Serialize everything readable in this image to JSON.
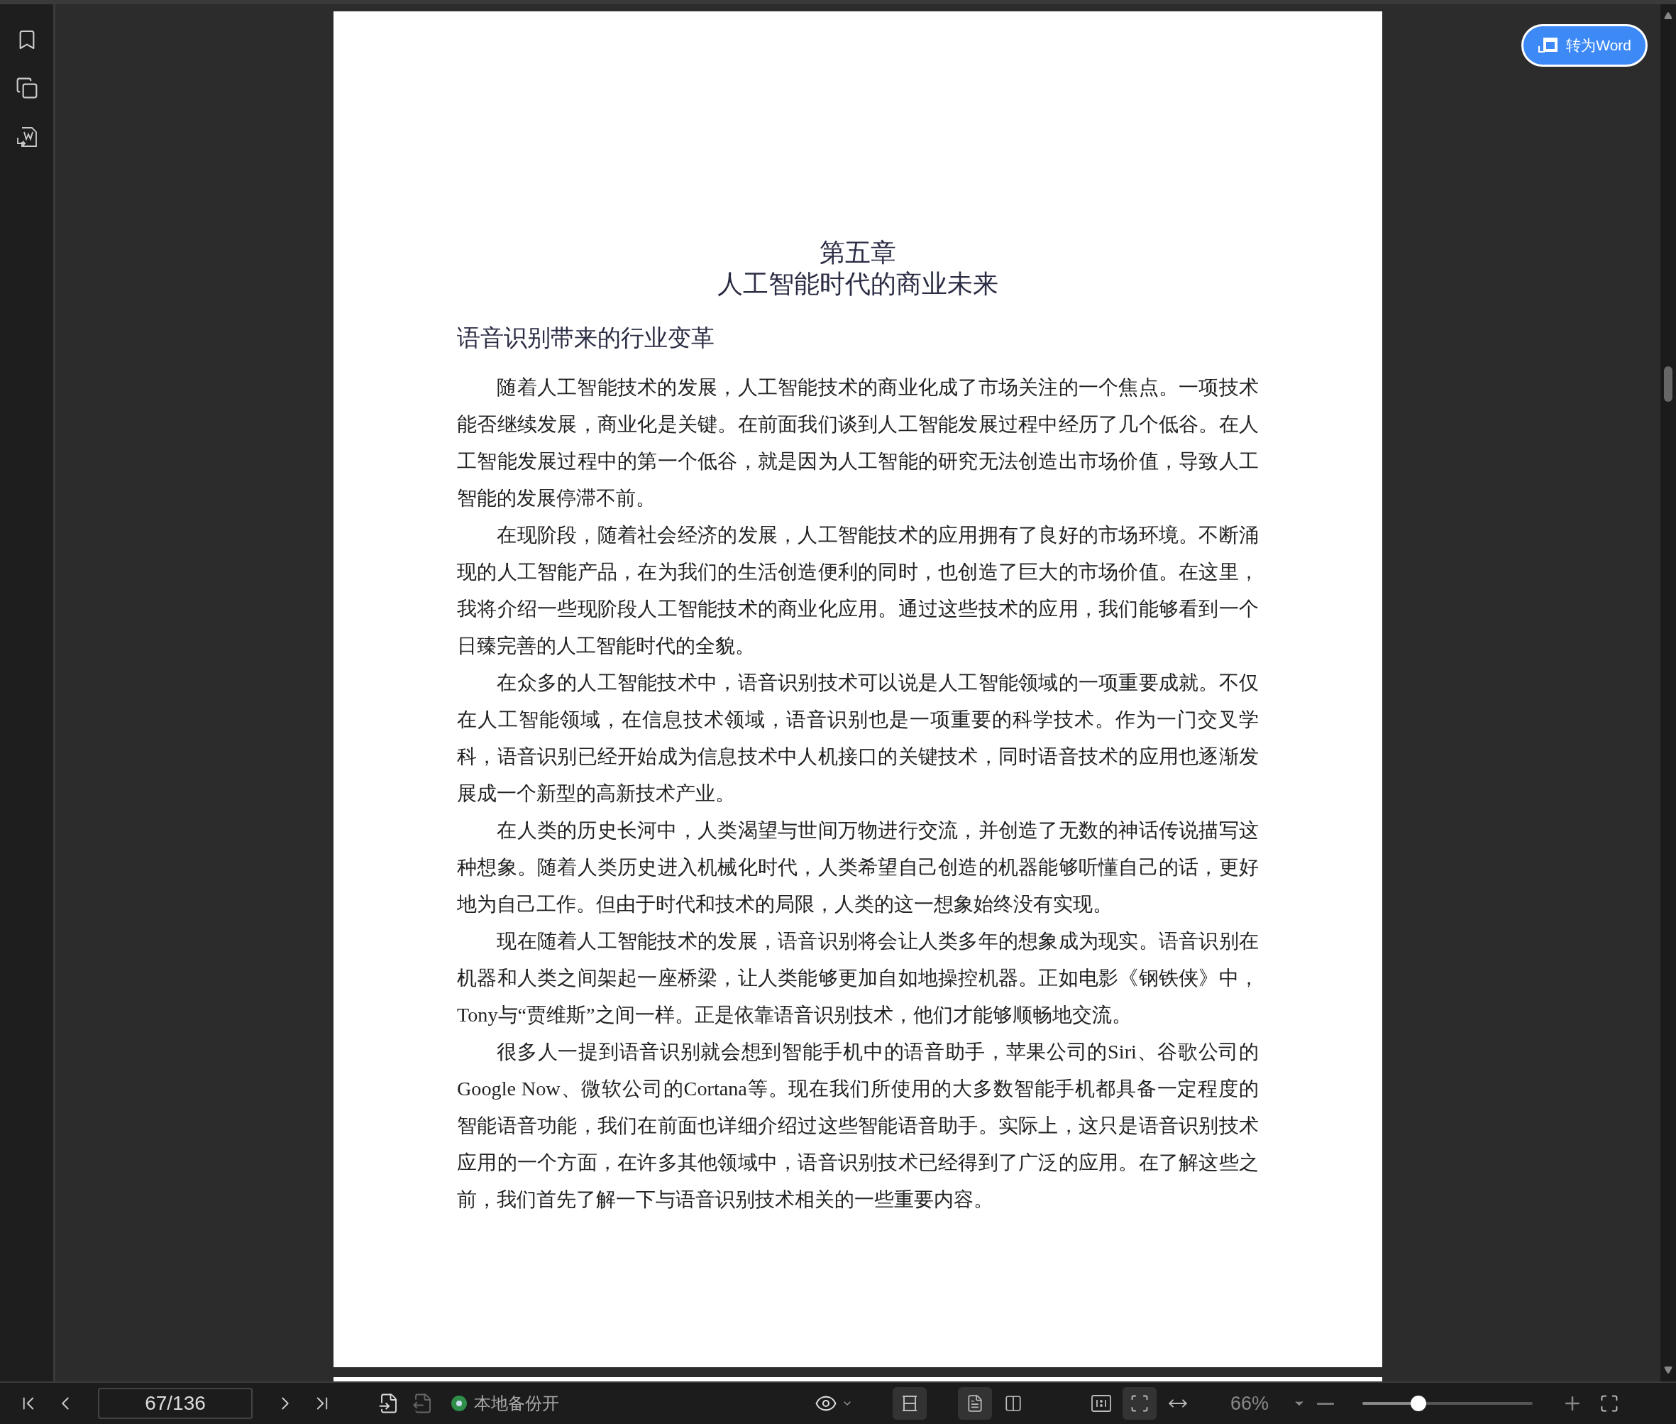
{
  "convert_button": {
    "label": "转为Word"
  },
  "page": {
    "chapter": "第五章",
    "title": "人工智能时代的商业未来",
    "section": "语音识别带来的行业变革",
    "paragraphs": [
      "随着人工智能技术的发展，人工智能技术的商业化成了市场关注的一个焦点。一项技术能否继续发展，商业化是关键。在前面我们谈到人工智能发展过程中经历了几个低谷。在人工智能发展过程中的第一个低谷，就是因为人工智能的研究无法创造出市场价值，导致人工智能的发展停滞不前。",
      "在现阶段，随着社会经济的发展，人工智能技术的应用拥有了良好的市场环境。不断涌现的人工智能产品，在为我们的生活创造便利的同时，也创造了巨大的市场价值。在这里，我将介绍一些现阶段人工智能技术的商业化应用。通过这些技术的应用，我们能够看到一个日臻完善的人工智能时代的全貌。",
      "在众多的人工智能技术中，语音识别技术可以说是人工智能领域的一项重要成就。不仅在人工智能领域，在信息技术领域，语音识别也是一项重要的科学技术。作为一门交叉学科，语音识别已经开始成为信息技术中人机接口的关键技术，同时语音技术的应用也逐渐发展成一个新型的高新技术产业。",
      "在人类的历史长河中，人类渴望与世间万物进行交流，并创造了无数的神话传说描写这种想象。随着人类历史进入机械化时代，人类希望自己创造的机器能够听懂自己的话，更好地为自己工作。但由于时代和技术的局限，人类的这一想象始终没有实现。",
      "现在随着人工智能技术的发展，语音识别将会让人类多年的想象成为现实。语音识别在机器和人类之间架起一座桥梁，让人类能够更加自如地操控机器。正如电影《钢铁侠》中， Tony与“贾维斯”之间一样。正是依靠语音识别技术，他们才能够顺畅地交流。",
      "很多人一提到语音识别就会想到智能手机中的语音助手，苹果公司的Siri、谷歌公司的Google Now、微软公司的Cortana等。现在我们所使用的大多数智能手机都具备一定程度的智能语音功能，我们在前面也详细介绍过这些智能语音助手。实际上，这只是语音识别技术应用的一个方面，在许多其他领域中，语音识别技术已经得到了广泛的应用。在了解这些之前，我们首先了解一下与语音识别技术相关的一些重要内容。"
    ]
  },
  "toolbar": {
    "page_indicator": "67/136",
    "backup": {
      "label": "本地备份开",
      "on": true
    },
    "layout_modes": [
      {
        "kind": "continuous",
        "selected": true
      }
    ],
    "page_modes": [
      {
        "kind": "single",
        "selected": true
      },
      {
        "kind": "double",
        "selected": false
      }
    ],
    "fit_modes": [
      {
        "kind": "actual",
        "selected": false
      },
      {
        "kind": "page",
        "selected": true
      },
      {
        "kind": "width",
        "selected": false
      }
    ],
    "zoom": {
      "reading": "66%",
      "level": 0.33
    }
  }
}
